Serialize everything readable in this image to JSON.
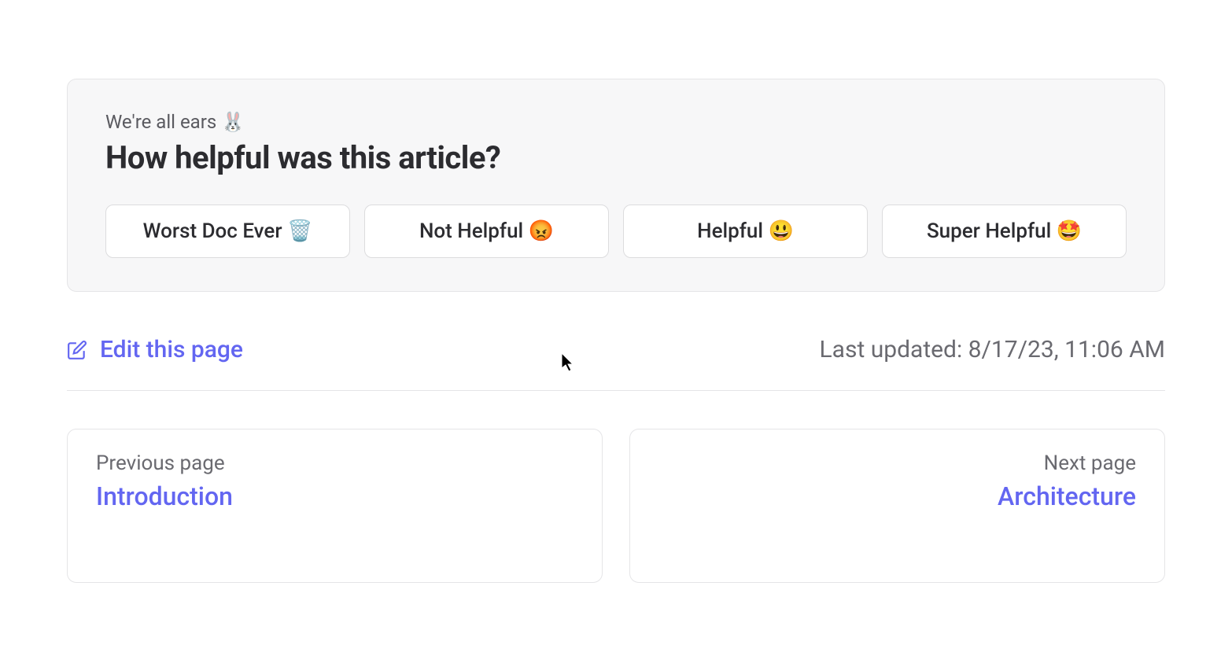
{
  "feedback": {
    "subtitle": "We're all ears 🐰",
    "title": "How helpful was this article?",
    "options": [
      "Worst Doc Ever 🗑️",
      "Not Helpful 😡",
      "Helpful 😃",
      "Super Helpful 🤩"
    ]
  },
  "edit_link_label": "Edit this page",
  "last_updated_label": "Last updated: 8/17/23, 11:06 AM",
  "nav": {
    "prev": {
      "label": "Previous page",
      "title": "Introduction"
    },
    "next": {
      "label": "Next page",
      "title": "Architecture"
    }
  }
}
